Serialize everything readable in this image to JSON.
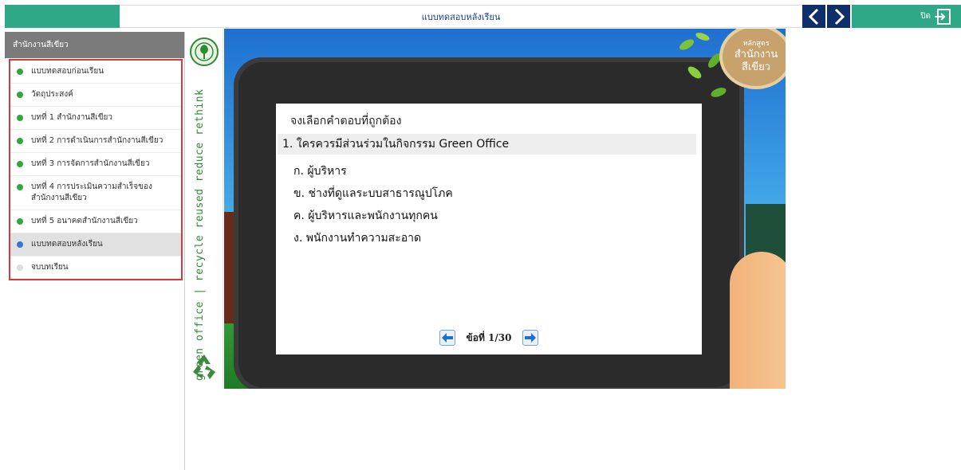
{
  "topbar": {
    "title": "แบบทดสอบหลังเรียน",
    "close_label": "ปิด"
  },
  "sidebar": {
    "header": "สำนักงานสีเขียว",
    "items": [
      {
        "label": "แบบทดสอบก่อนเรียน",
        "status": "done"
      },
      {
        "label": "วัตถุประสงค์",
        "status": "done"
      },
      {
        "label": "บทที่ 1 สำนักงานสีเขียว",
        "status": "done"
      },
      {
        "label": "บทที่ 2 การดำเนินการสำนักงานสีเขียว",
        "status": "done"
      },
      {
        "label": "บทที่ 3 การจัดการสำนักงานสีเขียว",
        "status": "done"
      },
      {
        "label": "บทที่ 4 การประเมินความสำเร็จของสำนักงานสีเขียว",
        "status": "done"
      },
      {
        "label": "บทที่ 5 อนาคตสำนักงานสีเขียว",
        "status": "done"
      },
      {
        "label": "แบบทดสอบหลังเรียน",
        "status": "current"
      },
      {
        "label": "จบบทเรียน",
        "status": "locked"
      }
    ]
  },
  "strip": {
    "text": "green office | recycle reused reduce rethink"
  },
  "badge": {
    "line1": "หลักสูตร",
    "line2": "สำนักงาน",
    "line3": "สีเขียว"
  },
  "quiz": {
    "instruction": "จงเลือกคำตอบที่ถูกต้อง",
    "question": "1. ใครควรมีส่วนร่วมในกิจกรรม Green Office",
    "options": [
      "ก. ผู้บริหาร",
      "ข. ช่างที่ดูแลระบบสาธารณูปโภค",
      "ค. ผู้บริหารและพนักงานทุกคน",
      "ง. พนักงานทำความสะอาด"
    ],
    "pager": "ข้อที่ 1/30"
  },
  "colors": {
    "brand_green": "#2fa888",
    "nav_dark": "#0f2f6a",
    "dot_done": "#2fa83b",
    "dot_current": "#3b73d1",
    "dot_locked": "#dddddd",
    "highlight_border": "#d9383b"
  }
}
